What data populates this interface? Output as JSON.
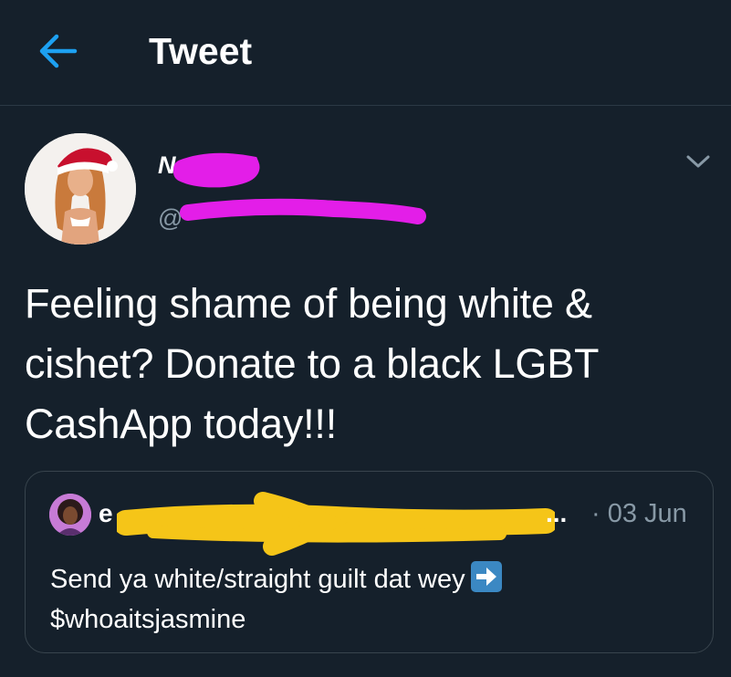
{
  "header": {
    "title": "Tweet"
  },
  "author": {
    "name_visible": "N",
    "handle_visible": "@"
  },
  "tweet": {
    "text": "Feeling shame of being white &\ncishet? Donate to a black LGBT\nCashApp today!!!"
  },
  "quoted_tweet": {
    "name_visible": "e",
    "ellipsis": "...",
    "date": "· 03 Jun",
    "text_line1": "Send ya white/straight guilt dat wey",
    "text_line2": "$whoaitsjasmine"
  },
  "colors": {
    "background": "#15202b",
    "accent": "#1da1f2",
    "muted_text": "#8899a6",
    "border": "#38444d",
    "redaction_magenta": "#e31ee8",
    "redaction_yellow": "#f5c518"
  },
  "icons": {
    "back": "arrow-left-icon",
    "menu": "chevron-down-icon",
    "emoji": "right-arrow-emoji-icon"
  }
}
